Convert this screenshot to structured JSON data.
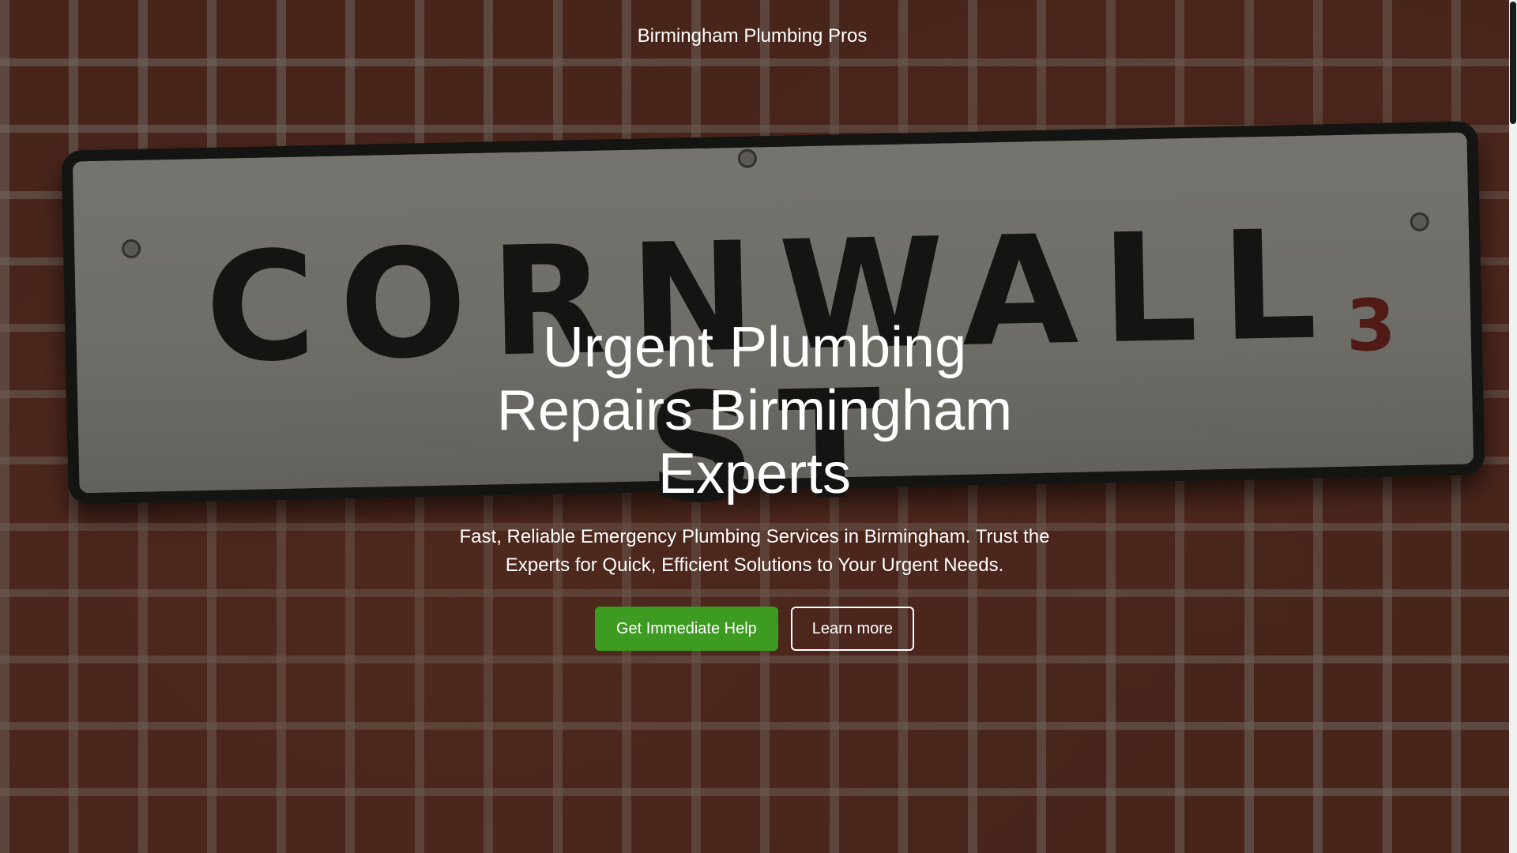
{
  "header": {
    "site_title": "Birmingham Plumbing Pros"
  },
  "background": {
    "sign_text": "CORNWALL ST",
    "sign_number": "3"
  },
  "hero": {
    "heading": "Urgent Plumbing Repairs Birmingham Experts",
    "subheading": "Fast, Reliable Emergency Plumbing Services in Birmingham. Trust the Experts for Quick, Efficient Solutions to Your Urgent Needs.",
    "primary_button": "Get Immediate Help",
    "secondary_button": "Learn more"
  },
  "colors": {
    "accent": "#3c9b20",
    "text": "#ffffff"
  }
}
